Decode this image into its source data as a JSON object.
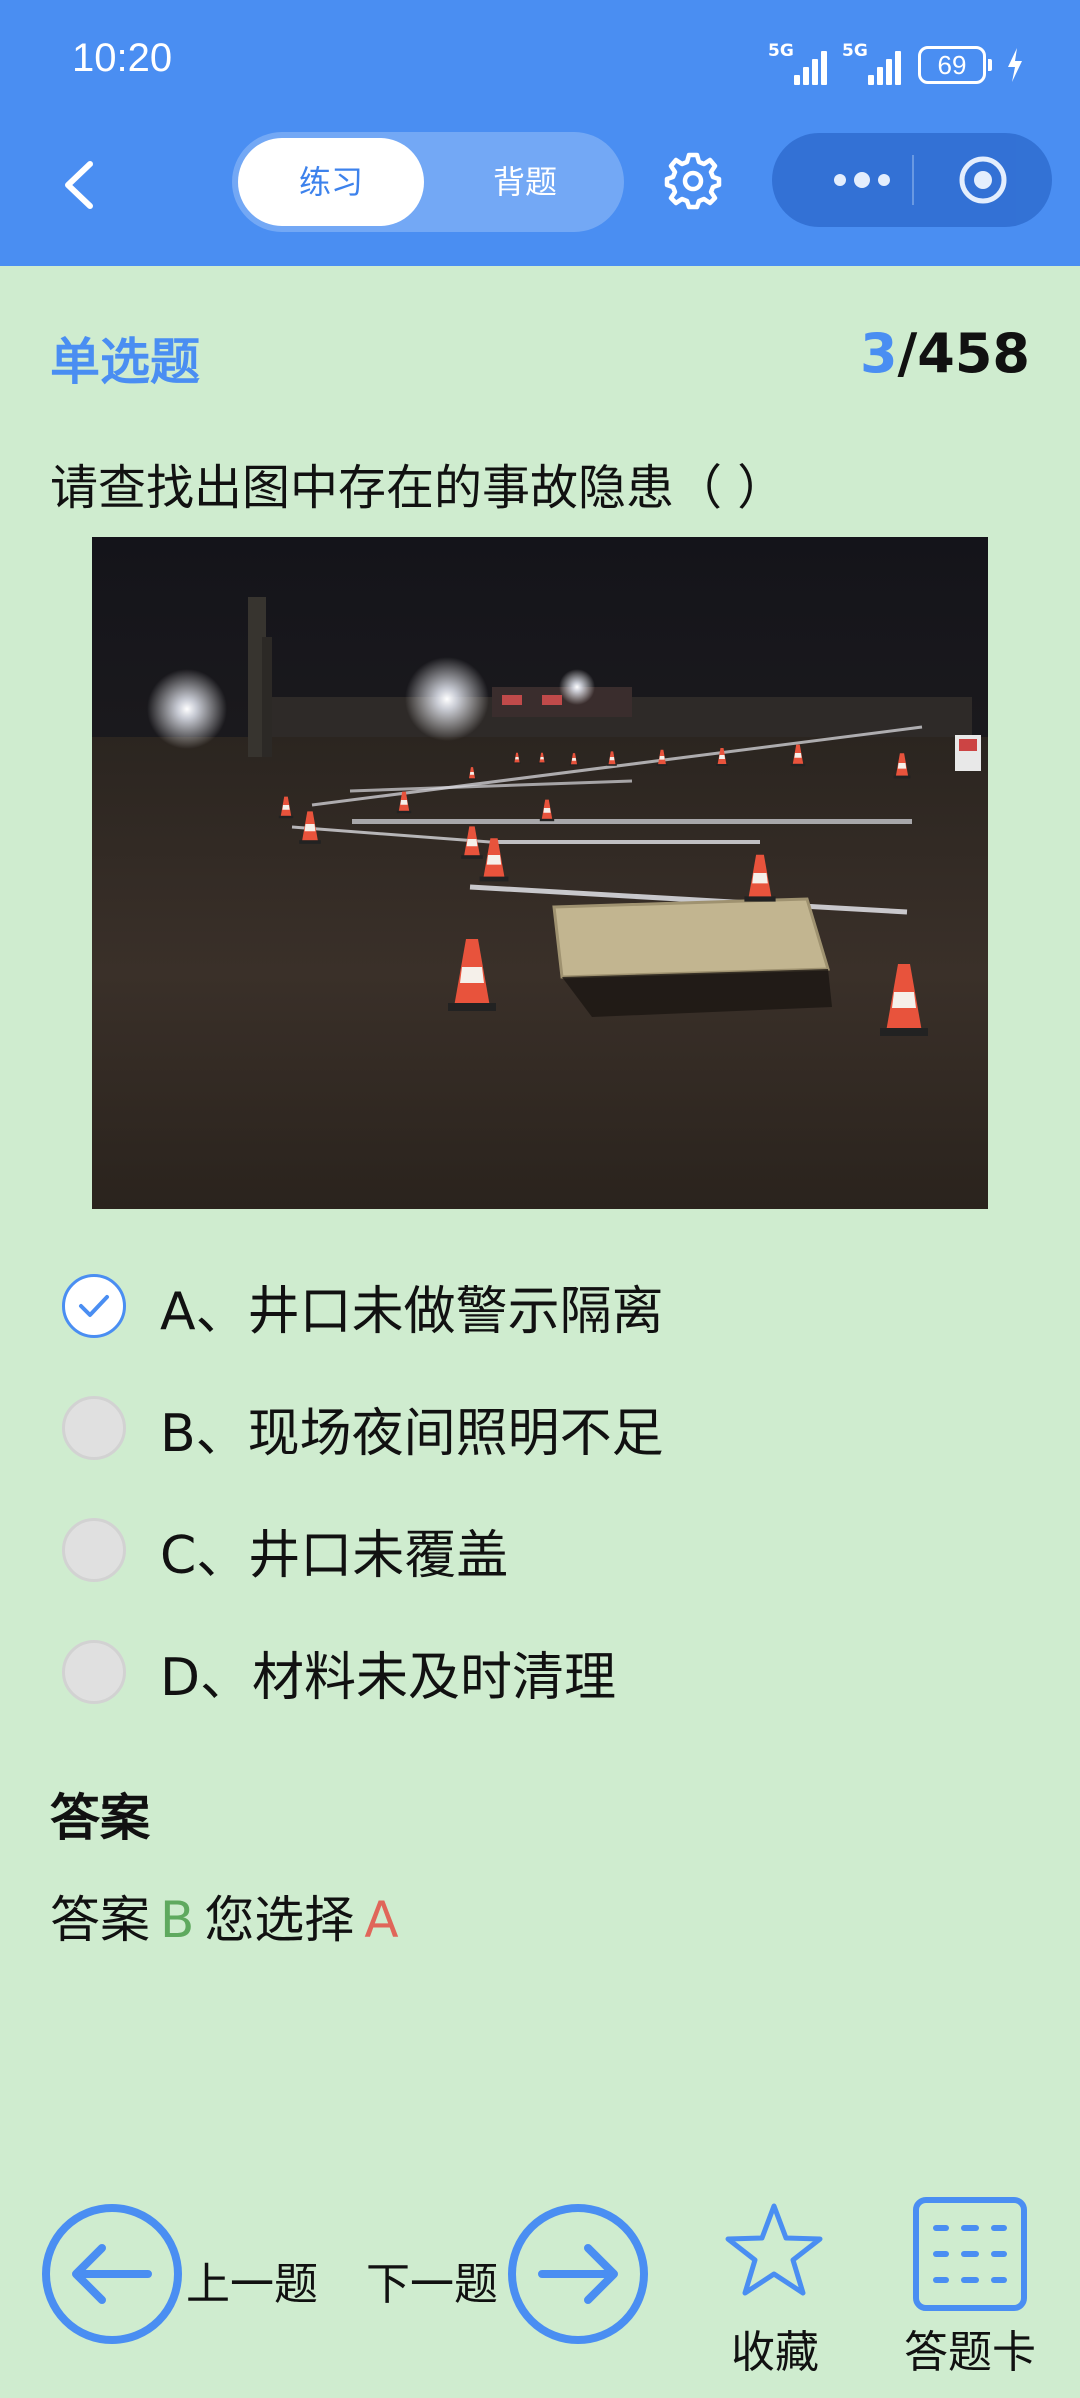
{
  "status_bar": {
    "time": "10:20",
    "network1": "5G",
    "network2": "5G",
    "battery": "69"
  },
  "header": {
    "tabs": [
      "练习",
      "背题"
    ],
    "active_tab": "练习"
  },
  "question": {
    "type": "单选题",
    "current": "3",
    "total": "/458",
    "text": "请查找出图中存在的事故隐患（ ）"
  },
  "options": [
    {
      "label": "A、井口未做警示隔离",
      "checked": true
    },
    {
      "label": "B、现场夜间照明不足",
      "checked": false
    },
    {
      "label": "C、井口未覆盖",
      "checked": false
    },
    {
      "label": "D、材料未及时清理",
      "checked": false
    }
  ],
  "answer": {
    "title": "答案",
    "prefix": "答案",
    "correct": "B",
    "chosen_label": "您选择",
    "chosen": "A"
  },
  "bottom": {
    "prev": "上一题",
    "next": "下一题",
    "favorite": "收藏",
    "answer_card": "答题卡"
  },
  "colors": {
    "accent": "#4a8ef2",
    "background": "#cfeccf",
    "correct": "#5fa95f",
    "wrong": "#e0665a"
  }
}
